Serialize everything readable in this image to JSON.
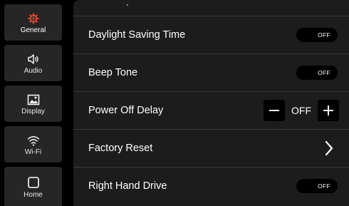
{
  "sidebar": {
    "items": [
      {
        "label": "General",
        "icon": "gear-icon",
        "active": true
      },
      {
        "label": "Audio",
        "icon": "speaker-icon",
        "active": false
      },
      {
        "label": "Display",
        "icon": "image-icon",
        "active": false
      },
      {
        "label": "Wi-Fi",
        "icon": "wifi-icon",
        "active": false
      },
      {
        "label": "Home",
        "icon": "home-square-icon",
        "active": false
      }
    ]
  },
  "settings": {
    "rows": [
      {
        "label": "Daylight Saving Time",
        "control": "toggle",
        "value": "OFF"
      },
      {
        "label": "Beep Tone",
        "control": "toggle",
        "value": "OFF"
      },
      {
        "label": "Power Off Delay",
        "control": "stepper",
        "value": "OFF"
      },
      {
        "label": "Factory Reset",
        "control": "chevron"
      },
      {
        "label": "Right Hand Drive",
        "control": "toggle",
        "value": "OFF"
      }
    ]
  },
  "colors": {
    "accent": "#e8432e",
    "panel_bg": "#1c1c1c",
    "nav_bg": "#262626"
  }
}
